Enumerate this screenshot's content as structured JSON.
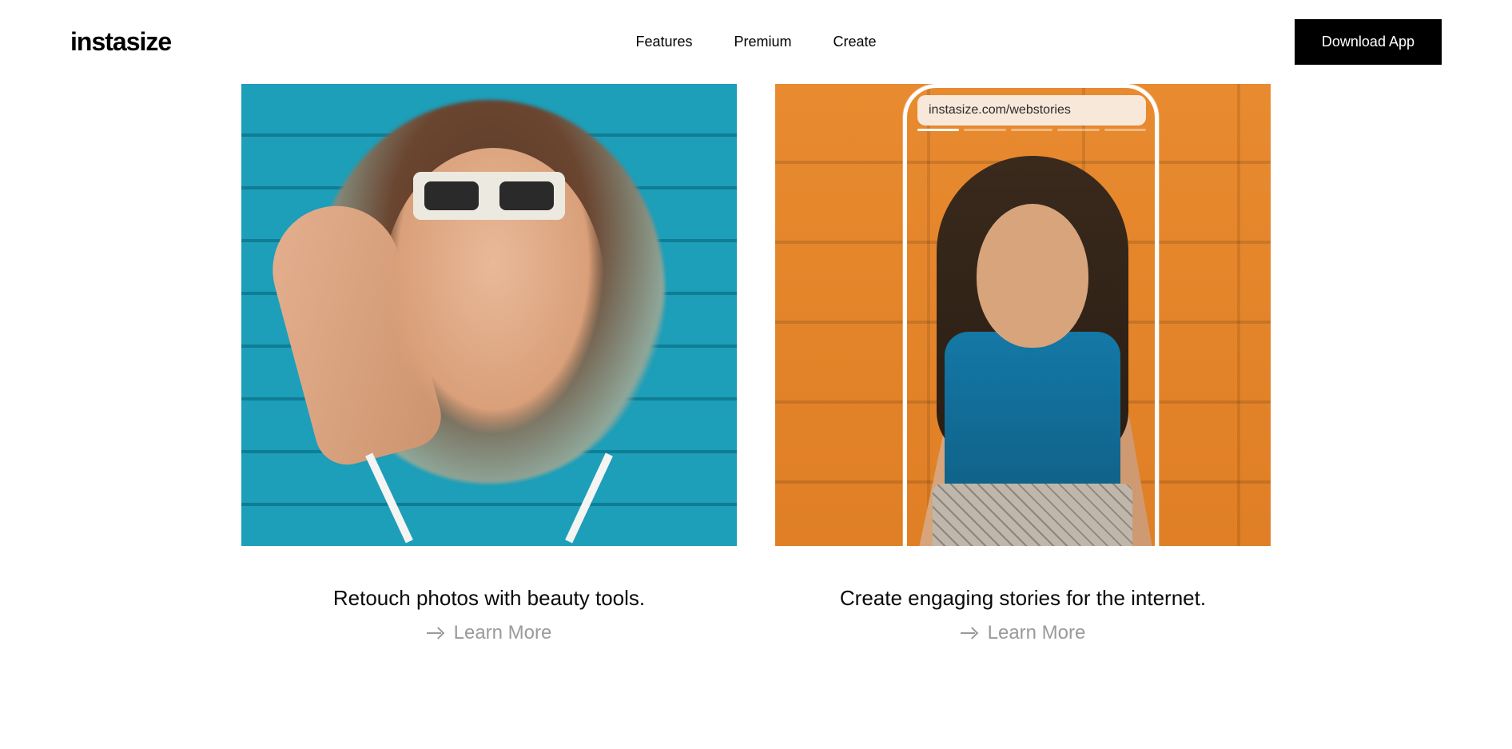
{
  "header": {
    "logo": "instasize",
    "nav": {
      "features": "Features",
      "premium": "Premium",
      "create": "Create"
    },
    "cta": "Download App"
  },
  "cards": {
    "left": {
      "title": "Retouch photos with beauty tools.",
      "link": "Learn More"
    },
    "right": {
      "url_pill": "instasize.com/webstories",
      "title": "Create engaging stories for the internet.",
      "link": "Learn More"
    }
  }
}
